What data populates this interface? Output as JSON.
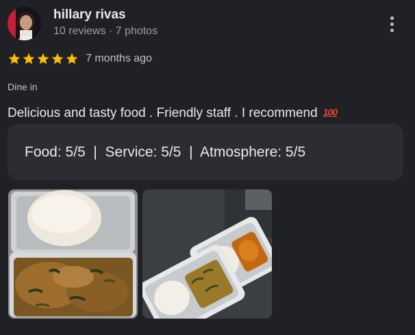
{
  "review": {
    "reviewer_name": "hillary rivas",
    "reviewer_meta": "10 reviews · 7 photos",
    "rating_stars": 5,
    "time_ago": "7 months ago",
    "service_type": "Dine in",
    "text": "Delicious and tasty food . Friendly staff . I recommend",
    "emoji": "💯",
    "ratings_line": "Food: 5/5  |  Service: 5/5  |  Atmosphere: 5/5",
    "icons": {
      "menu": "more-vert-icon",
      "star": "star-icon"
    },
    "colors": {
      "star": "#fbbc04",
      "background": "#202124",
      "ratings_box": "#2b2d30"
    },
    "photos": [
      {
        "name": "photo-fufu-egusi"
      },
      {
        "name": "photo-two-trays"
      }
    ]
  }
}
